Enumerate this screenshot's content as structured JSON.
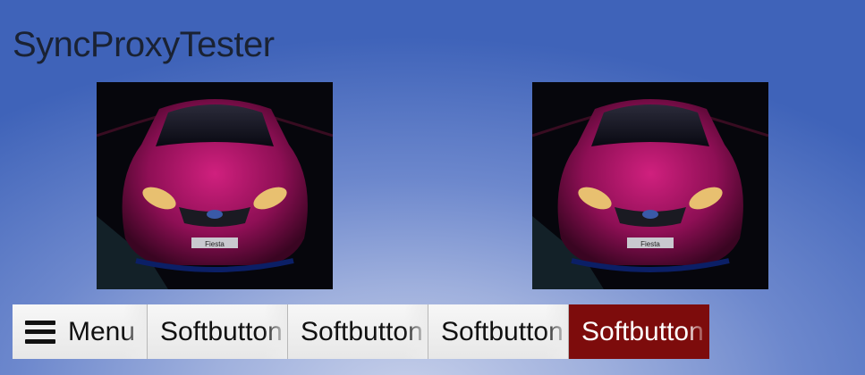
{
  "app": {
    "title": "SyncProxyTester"
  },
  "graphics": {
    "primary": {
      "icon": "car-photo-icon",
      "plate": "Fiesta"
    },
    "secondary": {
      "icon": "car-photo-icon",
      "plate": "Fiesta"
    }
  },
  "softbuttons": {
    "menu": {
      "label": "Menu",
      "icon": "hamburger-icon"
    },
    "items": [
      {
        "label": "Softbutton"
      },
      {
        "label": "Softbutton"
      },
      {
        "label": "Softbutton"
      },
      {
        "label": "Softbutton",
        "highlighted": true
      }
    ]
  },
  "colors": {
    "highlight": "#7d0c0c",
    "background": "#5a7ac4"
  }
}
